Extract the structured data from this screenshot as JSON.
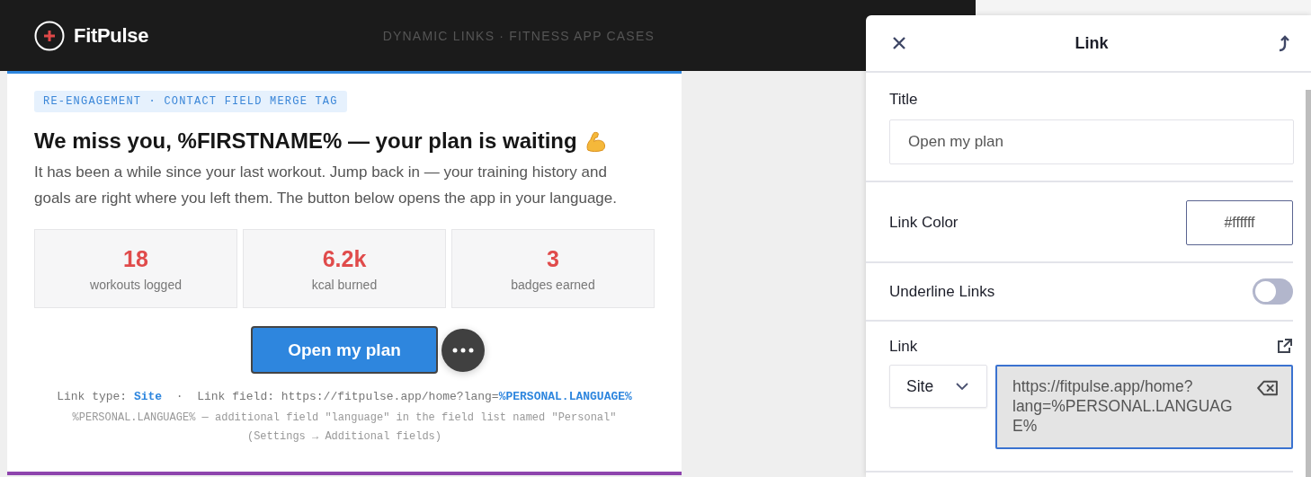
{
  "header": {
    "logo_text": "FitPulse",
    "tagline": "DYNAMIC LINKS · FITNESS APP CASES"
  },
  "email": {
    "tag": "RE-ENGAGEMENT · CONTACT FIELD MERGE TAG",
    "heading": "We miss you, %FIRSTNAME% — your plan is waiting",
    "intro": "It has been a while since your last workout. Jump back in — your training history and goals are right where you left them. The button below opens the app in your language.",
    "stats": [
      {
        "value": "18",
        "label": "workouts logged"
      },
      {
        "value": "6.2k",
        "label": "kcal burned"
      },
      {
        "value": "3",
        "label": "badges earned"
      }
    ],
    "button": {
      "label": "Open my plan"
    },
    "link_note": "Link type: **Site**  ·  Link field: https://fitpulse.app/home?lang=**%PERSONAL.LANGUAGE%**",
    "field_note": "%PERSONAL.LANGUAGE% — additional field \"language\" in the field list named \"Personal\" (Settings → Additional fields)"
  },
  "panel": {
    "title": "Link",
    "title_field": {
      "label": "Title",
      "value": "Open my plan"
    },
    "link_color": {
      "label": "Link Color",
      "value": "#ffffff"
    },
    "underline": {
      "label": "Underline Links",
      "on": false
    },
    "link": {
      "label": "Link",
      "type": "Site",
      "url": "https://fitpulse.app/home?lang=%PERSONAL.LANGUAGE%"
    }
  }
}
